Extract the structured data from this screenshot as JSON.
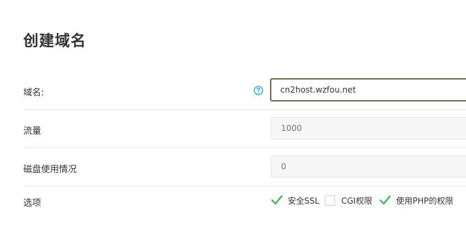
{
  "page": {
    "title": "创建域名"
  },
  "form": {
    "domain": {
      "label": "域名:",
      "value": "cn2host.wzfou.net",
      "help_icon": "question-circle-icon",
      "help_color": "#1aa1e6"
    },
    "traffic": {
      "label": "流量",
      "placeholder": "1000"
    },
    "disk_usage": {
      "label": "磁盘使用情况",
      "placeholder": "0"
    },
    "options": {
      "label": "选项",
      "items": [
        {
          "label": "安全SSL",
          "checked": true
        },
        {
          "label": "CGI权限",
          "checked": false
        },
        {
          "label": "使用PHP的权限",
          "checked": true
        }
      ],
      "check_color": "#3cb05a"
    }
  }
}
